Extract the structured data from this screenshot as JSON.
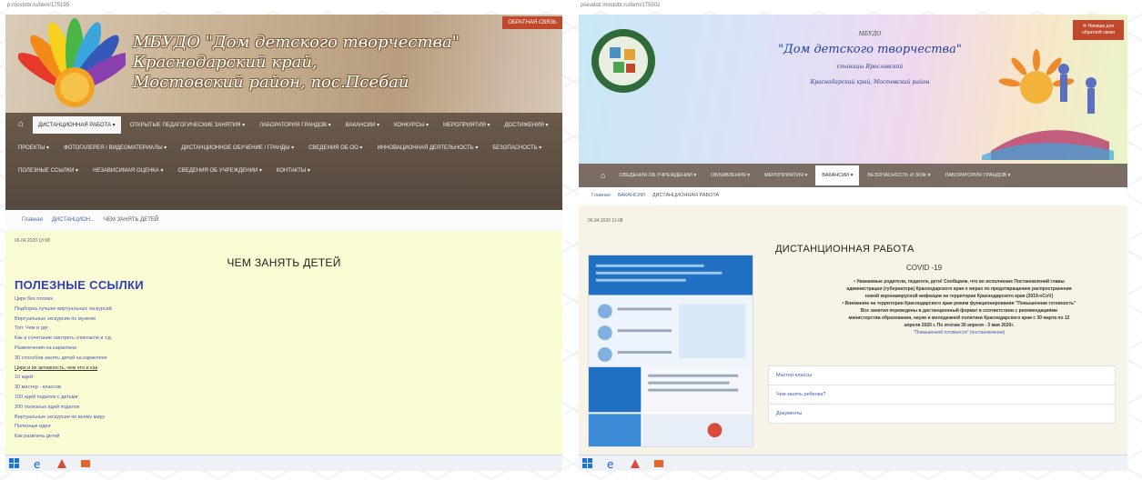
{
  "left": {
    "url": "p.mostobr.ru/item/175195",
    "site_title_lines": [
      "МБУДО \"Дом детского творчества\"",
      "Краснодарский край,",
      "Мостовский район, пос.Псебай"
    ],
    "feedback_label": "ОБРАТНАЯ СВЯЗЬ",
    "nav": {
      "home_icon": "home-icon",
      "items": [
        "ДИСТАНЦИОННАЯ РАБОТА ▾",
        "ОТКРЫТЫЕ ПЕДАГОГИЧЕСКИЕ ЗАНЯТИЯ ▾",
        "ЛАБОРАТОРИЯ ГРАНДОВ ▾",
        "ВАКАНСИИ ▾",
        "КОНКУРСЫ ▾",
        "МЕРОПРИЯТИЯ ▾",
        "ДОСТИЖЕНИЯ ▾",
        "ПРОЕКТЫ ▾",
        "ФОТОГАЛЕРЕЯ / ВИДЕОМАТЕРИАЛЫ ▾",
        "ДИСТАНЦИОННОЕ ОБУЧЕНИЕ / ГРАНДЫ ▾",
        "СВЕДЕНИЯ ОБ ОО ▾",
        "ИННОВАЦИОННАЯ ДЕЯТЕЛЬНОСТЬ ▾",
        "БЕЗОПАСНОСТЬ ▾",
        "ПОЛЕЗНЫЕ ССЫЛКИ ▾",
        "НЕЗАВИСИМАЯ ОЦЕНКА ▾",
        "СВЕДЕНИЯ ОБ УЧРЕЖДЕНИИ ▾",
        "КОНТАКТЫ ▾"
      ],
      "active_index": 0
    },
    "breadcrumb": [
      "Главная",
      "ДИСТАНЦИОН...",
      "ЧЕМ ЗАНЯТЬ ДЕТЕЙ"
    ],
    "date": "06.04.2020 10:08",
    "page_title": "ЧЕМ ЗАНЯТЬ ДЕТЕЙ",
    "section_title": "ПОЛЕЗНЫЕ ССЫЛКИ",
    "links": [
      "Цирк без плохих",
      "Подборка лучших виртуальных экскурсий",
      "Виртуальные экскурсии по музеям",
      "Топ: Чем и где",
      "Как и сочетание смотреть спектакли и т.д.",
      "Развлечения на карантине",
      "30 способов занять детей на карантине",
      "Цирк и их активность, чем что и как",
      "10 идей",
      "30 мастер - классов",
      "100 идей поделок с детьми",
      "200 полезных идей поделок",
      "Виртуальные экскурсии по всему миру",
      "Полезные идеи",
      "Как развлечь детей"
    ],
    "underline_link_index": 7,
    "taskbar_icons": [
      "windows-icon",
      "edge-icon",
      "app-icon",
      "office-icon"
    ]
  },
  "right": {
    "url": "pseudoz.mostobr.ru/item/175502",
    "header_small": "МБУДО",
    "header_big": "\"Дом детского творчества\"",
    "header_sub1": "станицы Ярославской",
    "header_sub2": "Краснодарский край, Мостовский район",
    "feedback_label": "✉ Напиши для обратной связи",
    "nav": {
      "home_icon": "home-icon",
      "items": [
        "СВЕДЕНИЯ ОБ УЧРЕЖДЕНИИ ▾",
        "ОБЪЯВЛЕНИЯ ▾",
        "МЕРОПРИЯТИЯ ▾",
        "ВАКАНСИИ ▾",
        "БЕЗОПАСНОСТЬ И ЗОЖ ▾",
        "ЛАБОРАТОРИЯ ГРАНДОВ ▾"
      ],
      "active_index": 3
    },
    "breadcrumb": [
      "Главная",
      "ВАКАНСИИ",
      "ДИСТАНЦИОННАЯ РАБОТА"
    ],
    "date": "06.04.2020 11:08",
    "page_title": "ДИСТАНЦИОННАЯ РАБОТА",
    "covid": "COVID -19",
    "body_lines": [
      "• Уважаемые родители, педагоги, дети! Сообщаем, что во исполнение Постановлений главы",
      "администрации (губернатора) Краснодарского края о мерах по предотвращению распространения",
      "новой коронавирусной инфекции на территории Краснодарского края (2019-nCoV)",
      "• Вниманию на территории Краснодарского края режим функционирования \"Повышенная готовность\"",
      "Все занятия переведены в дистанционный формат в соответствии с рекомендациями",
      "министерства образования, науки и молодежной политики Краснодарского края с 30 марта по 12",
      "апреля 2020 г. По итогам 30 апреля - 3 мая 2020г."
    ],
    "body_link": "\"Повышенной готовности\" (постановления)",
    "accordion": [
      "Мастер-классы",
      "Чем занять ребенка?",
      "Документы"
    ],
    "taskbar_icons": [
      "windows-icon",
      "edge-icon",
      "app-icon",
      "office-icon"
    ]
  },
  "colors": {
    "left_content_bg": "#fbfbd4",
    "left_section_title": "#2d3fbf",
    "nav_brown": "#6b5a4a",
    "feedback_red": "#c0492b",
    "right_content_bg": "#f7f3e6"
  }
}
